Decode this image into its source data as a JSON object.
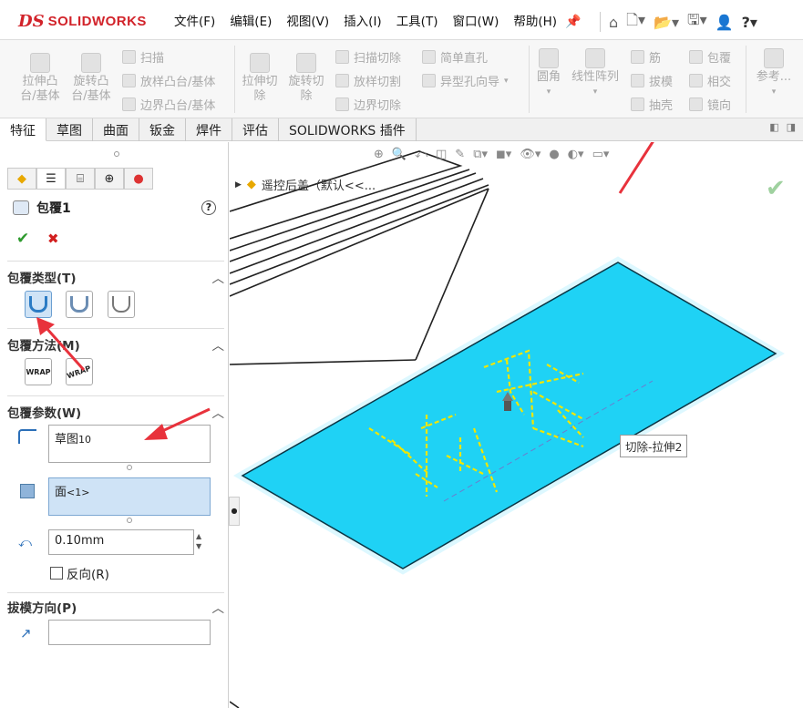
{
  "app": {
    "brand_prefix": "DS",
    "brand": "SOLIDWORKS"
  },
  "menu": [
    "文件(F)",
    "编辑(E)",
    "视图(V)",
    "插入(I)",
    "工具(T)",
    "窗口(W)",
    "帮助(H)"
  ],
  "ribbon": {
    "extrude_boss": "拉伸凸\n台/基体",
    "revolve_boss": "旋转凸\n台/基体",
    "sweep": "扫描",
    "loft": "放样凸台/基体",
    "boundary_boss": "边界凸台/基体",
    "extrude_cut": "拉伸切\n除",
    "revolve_cut": "旋转切\n除",
    "swept_cut": "扫描切除",
    "lofted_cut": "放样切割",
    "boundary_cut": "边界切除",
    "simple_hole": "简单直孔",
    "hole_wizard": "异型孔向导",
    "fillet": "圆角",
    "linear_pattern": "线性阵列",
    "rib": "筋",
    "draft": "拔模",
    "shell": "抽壳",
    "wrap": "包覆",
    "intersect": "相交",
    "mirror": "镜向",
    "reference": "参考..."
  },
  "tabs": [
    "特征",
    "草图",
    "曲面",
    "钣金",
    "焊件",
    "评估",
    "SOLIDWORKS 插件"
  ],
  "tree": {
    "label": "遥控后盖（默认<<..."
  },
  "property": {
    "title": "包覆1",
    "help": "?",
    "ok": "✔",
    "cancel": "✖",
    "wrap_type_header": "包覆类型(T)",
    "wrap_method_header": "包覆方法(M)",
    "wrap_params_header": "包覆参数(W)",
    "sketch_value": "草图",
    "sketch_number": "10",
    "face_value": "面",
    "face_suffix": "<1>",
    "depth_value": "0.10mm",
    "reverse_label": "反向(R)",
    "pull_dir_header": "拔模方向(P)"
  },
  "tooltip": "切除-拉伸2",
  "colors": {
    "accent": "#3a73b8",
    "brand": "#d2232a",
    "face": "#1fd2f5",
    "arrow": "#e8323c",
    "ok": "#2e9a2e",
    "cancel": "#d21f1f"
  }
}
